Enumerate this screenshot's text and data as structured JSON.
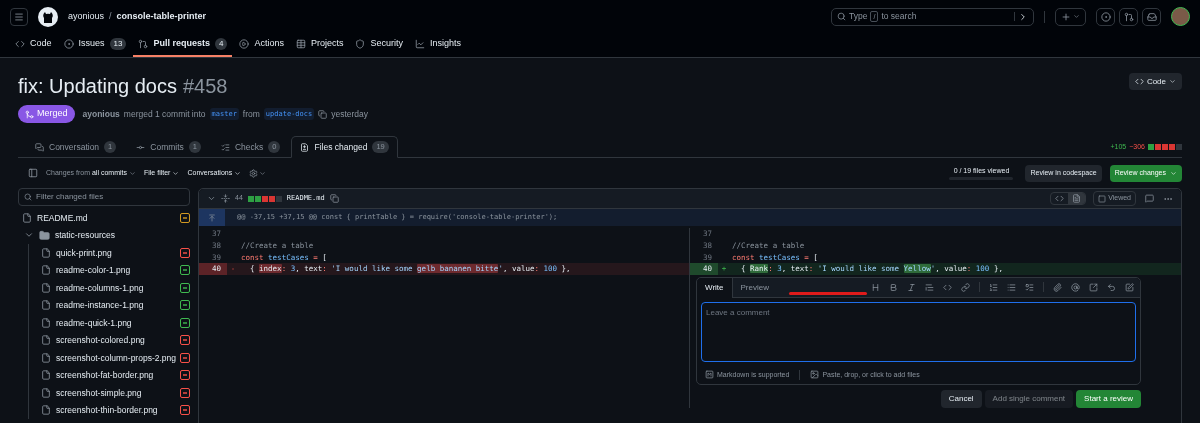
{
  "repo": {
    "owner": "ayonious",
    "separator": "/",
    "name": "console-table-printer"
  },
  "search": {
    "before": "Type",
    "key": "/",
    "after": "to search"
  },
  "repo_nav": [
    {
      "label": "Code",
      "selected": false
    },
    {
      "label": "Issues",
      "count": "13",
      "selected": false
    },
    {
      "label": "Pull requests",
      "count": "4",
      "selected": true
    },
    {
      "label": "Actions",
      "selected": false
    },
    {
      "label": "Projects",
      "selected": false
    },
    {
      "label": "Security",
      "selected": false
    },
    {
      "label": "Insights",
      "selected": false
    }
  ],
  "pr": {
    "title": "fix: Updating docs",
    "number": "#458",
    "state": "Merged",
    "author": "ayonious",
    "action": "merged 1 commit into",
    "base": "master",
    "from": "from",
    "head": "update-docs",
    "time": "yesterday"
  },
  "code_button": "Code",
  "pr_tabs": [
    {
      "label": "Conversation",
      "count": "1",
      "selected": false
    },
    {
      "label": "Commits",
      "count": "1",
      "selected": false
    },
    {
      "label": "Checks",
      "count": "0",
      "selected": false
    },
    {
      "label": "Files changed",
      "count": "19",
      "selected": true
    }
  ],
  "diffstat": {
    "additions": "+105",
    "deletions": "−306"
  },
  "toolbar": {
    "changes_label": "Changes from",
    "changes_value": "all commits",
    "file_filter": "File filter",
    "conversations": "Conversations"
  },
  "files_viewed": {
    "text": "0 / 19 files viewed",
    "level": 0
  },
  "review_codespace": "Review in codespace",
  "review_changes": "Review changes",
  "file_filter": {
    "placeholder": "Filter changed files"
  },
  "tree": [
    {
      "name": "README.md",
      "kind": "file",
      "color": "#d29922"
    },
    {
      "name": "static-resources",
      "kind": "folder",
      "expanded": true,
      "children": [
        {
          "name": "quick-print.png",
          "kind": "file",
          "color": "#f85149"
        },
        {
          "name": "readme-color-1.png",
          "kind": "file",
          "color": "#3fb950"
        },
        {
          "name": "readme-columns-1.png",
          "kind": "file",
          "color": "#3fb950"
        },
        {
          "name": "readme-instance-1.png",
          "kind": "file",
          "color": "#3fb950"
        },
        {
          "name": "readme-quick-1.png",
          "kind": "file",
          "color": "#3fb950"
        },
        {
          "name": "screenshot-colored.png",
          "kind": "file",
          "color": "#f85149"
        },
        {
          "name": "screenshot-column-props-2.png",
          "kind": "file",
          "color": "#f85149"
        },
        {
          "name": "screenshot-fat-border.png",
          "kind": "file",
          "color": "#f85149"
        },
        {
          "name": "screenshot-simple.png",
          "kind": "file",
          "color": "#f85149"
        },
        {
          "name": "screenshot-thin-border.png",
          "kind": "file",
          "color": "#f85149"
        }
      ]
    }
  ],
  "diff_file": {
    "expanded": true,
    "changes": "44",
    "name": "README.md",
    "viewed": false,
    "viewed_label": "Viewed",
    "view_buttons": [
      {
        "selected": false
      },
      {
        "selected": true
      }
    ]
  },
  "hunk": "@@ -37,15 +37,15 @@ const { printTable } = require('console-table-printer');",
  "left_lines": [
    {
      "number": "37",
      "kind": "context"
    },
    {
      "number": "38",
      "kind": "context",
      "segments": [
        {
          "text": "//Create a table",
          "kind": "comment"
        }
      ]
    },
    {
      "number": "39",
      "kind": "context",
      "segments": [
        {
          "text": "const",
          "kind": "kw"
        },
        {
          "text": " testCases",
          "kind": "name"
        },
        {
          "text": " = ",
          "kind": "kw"
        },
        {
          "text": "[",
          "kind": "plain"
        }
      ]
    },
    {
      "number": "40",
      "kind": "deleted",
      "sign": "-",
      "segments": [
        {
          "text": "  { ",
          "kind": "plain"
        },
        {
          "text": "index",
          "kind": "plain",
          "marked": true
        },
        {
          "text": ": ",
          "kind": "kw"
        },
        {
          "text": "3",
          "kind": "num"
        },
        {
          "text": ", text",
          "kind": "plain"
        },
        {
          "text": ": ",
          "kind": "kw"
        },
        {
          "text": "'I would like some ",
          "kind": "str"
        },
        {
          "text": "gelb bananen bitte",
          "kind": "str",
          "marked": true
        },
        {
          "text": "'",
          "kind": "str"
        },
        {
          "text": ", value",
          "kind": "plain"
        },
        {
          "text": ": ",
          "kind": "kw"
        },
        {
          "text": "100",
          "kind": "num"
        },
        {
          "text": " },",
          "kind": "plain"
        }
      ]
    }
  ],
  "right_lines": [
    {
      "number": "37",
      "kind": "context"
    },
    {
      "number": "38",
      "kind": "context",
      "segments": [
        {
          "text": "//Create a table",
          "kind": "comment"
        }
      ]
    },
    {
      "number": "39",
      "kind": "context",
      "segments": [
        {
          "text": "const",
          "kind": "kw"
        },
        {
          "text": " testCases",
          "kind": "name"
        },
        {
          "text": " = ",
          "kind": "kw"
        },
        {
          "text": "[",
          "kind": "plain"
        }
      ]
    },
    {
      "number": "40",
      "kind": "added",
      "sign": "+",
      "segments": [
        {
          "text": "  { ",
          "kind": "plain"
        },
        {
          "text": "Rank",
          "kind": "plain",
          "marked": true
        },
        {
          "text": ": ",
          "kind": "kw"
        },
        {
          "text": "3",
          "kind": "num"
        },
        {
          "text": ", text",
          "kind": "plain"
        },
        {
          "text": ": ",
          "kind": "kw"
        },
        {
          "text": "'I would like some ",
          "kind": "str"
        },
        {
          "text": "Yellow",
          "kind": "str",
          "marked": true
        },
        {
          "text": "'",
          "kind": "str"
        },
        {
          "text": ", value",
          "kind": "plain"
        },
        {
          "text": ": ",
          "kind": "kw"
        },
        {
          "text": "100",
          "kind": "num"
        },
        {
          "text": " },",
          "kind": "plain"
        }
      ]
    }
  ],
  "comment": {
    "tabs": [
      {
        "label": "Write",
        "selected": true
      },
      {
        "label": "Preview",
        "selected": false
      }
    ],
    "placeholder": "Leave a comment",
    "markdown_note": "Markdown is supported",
    "attach_note": "Paste, drop, or click to add files",
    "buttons": [
      {
        "label": "Cancel",
        "kind": "default",
        "disabled": false
      },
      {
        "label": "Add single comment",
        "kind": "default",
        "disabled": true
      },
      {
        "label": "Start a review",
        "kind": "primary",
        "disabled": false
      }
    ]
  }
}
